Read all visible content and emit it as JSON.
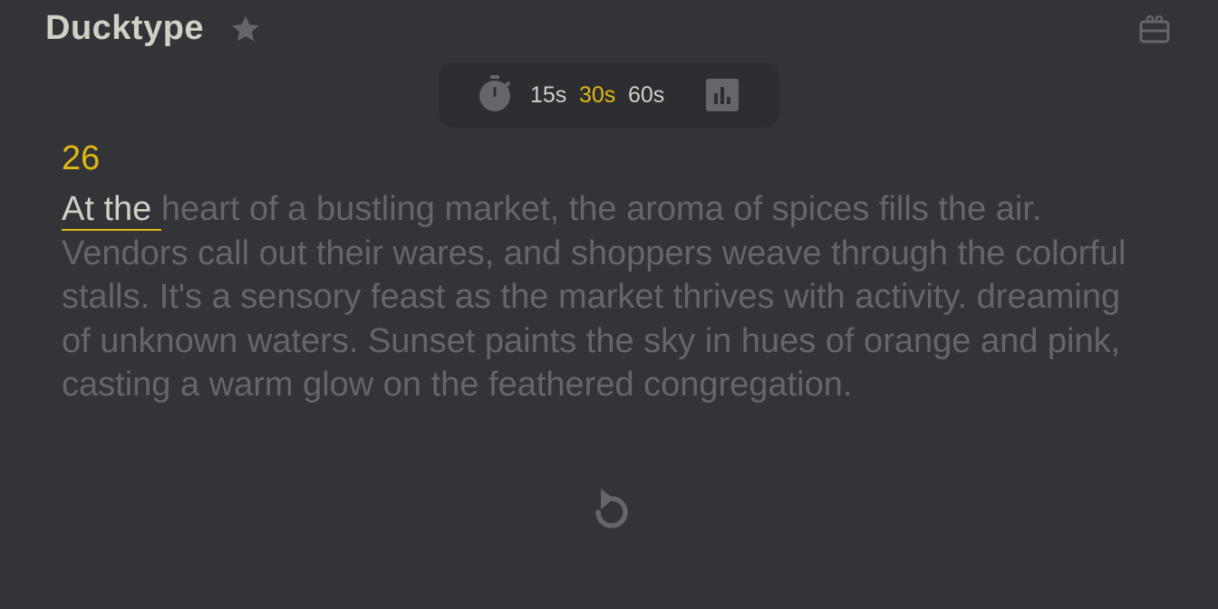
{
  "header": {
    "brand": "Ducktype",
    "favorite_icon": "star-icon",
    "gift_icon": "gift-icon"
  },
  "mode_bar": {
    "timer_icon": "stopwatch-icon",
    "options": [
      "15s",
      "30s",
      "60s"
    ],
    "selected": "30s",
    "stats_icon": "bar-chart-icon"
  },
  "test": {
    "counter": "26",
    "typed_text": "At the ",
    "remaining_text": "heart of a bustling market, the aroma of spices fills the air. Vendors call out their wares, and shoppers weave through the colorful stalls. It's a sensory feast as the market thrives with activity. dreaming of unknown waters. Sunset paints the sky in hues of orange and pink, casting a warm glow on the feathered congregation."
  },
  "footer": {
    "restart_icon": "restart-icon"
  },
  "colors": {
    "background": "#323437",
    "accent": "#e2b714",
    "text_main": "#d1d0c5",
    "text_sub": "#646669"
  }
}
